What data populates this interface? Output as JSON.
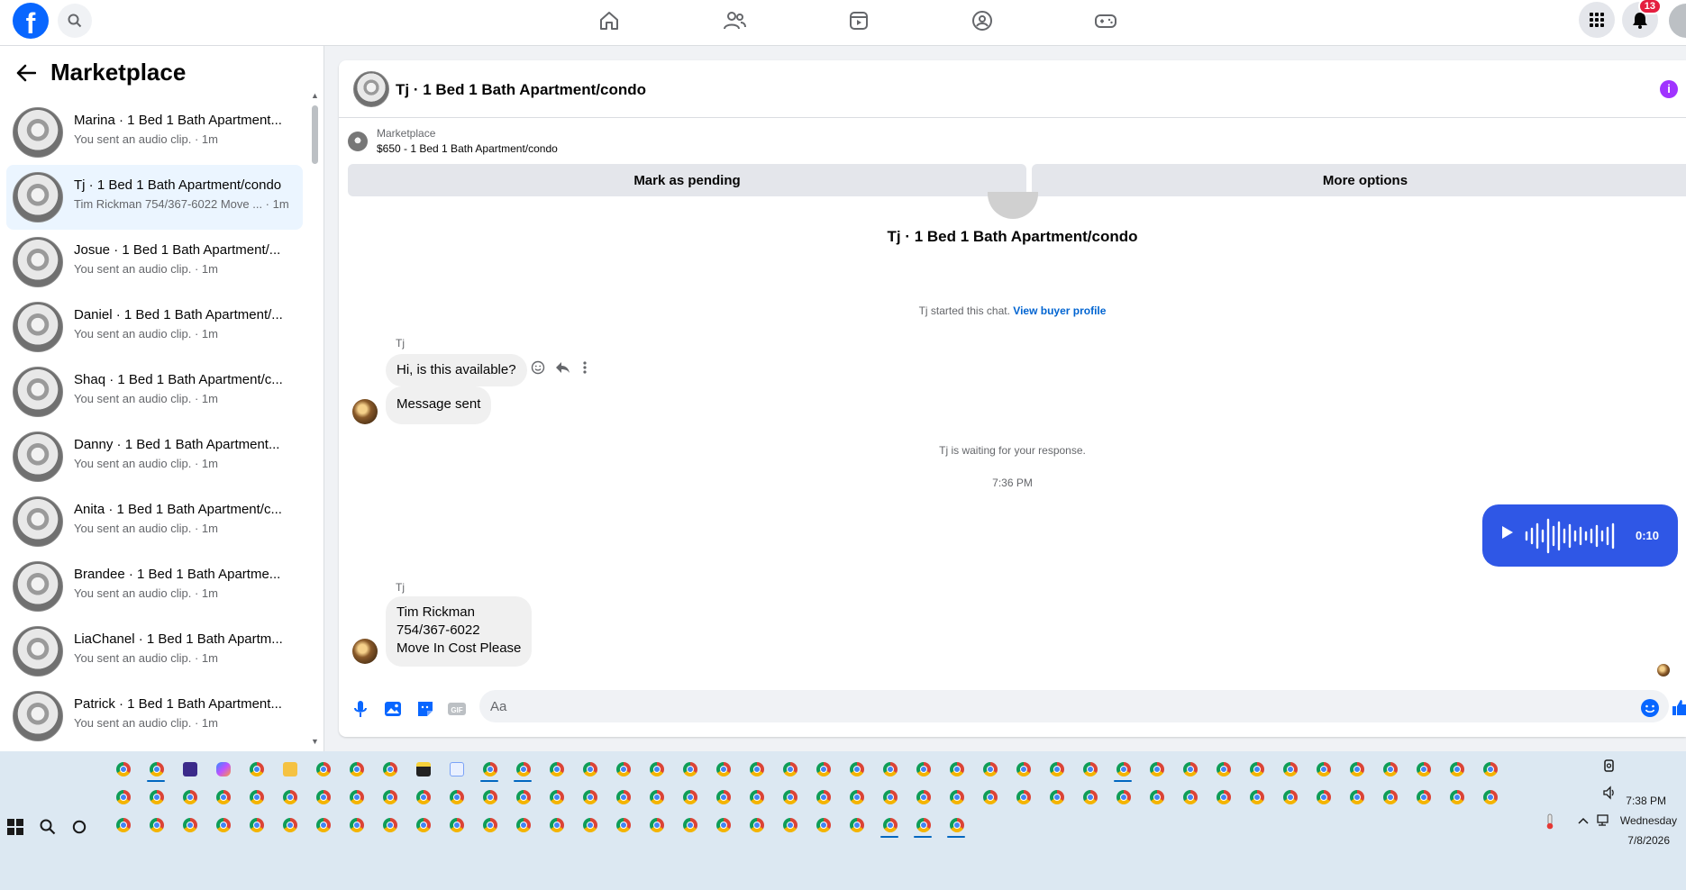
{
  "topbar": {
    "logo": "f",
    "notifications_count": "13",
    "nav_icons": [
      "home-icon",
      "friends-icon",
      "watch-icon",
      "groups-icon",
      "gaming-icon"
    ]
  },
  "marketplace": {
    "title": "Marketplace",
    "conversations": [
      {
        "title": "Marina · 1 Bed 1 Bath Apartment...",
        "sub": "You sent an audio clip. · 1m"
      },
      {
        "title": "Tj · 1 Bed 1 Bath Apartment/condo",
        "sub": "Tim Rickman 754/367-6022 Move ... · 1m"
      },
      {
        "title": "Josue · 1 Bed 1 Bath Apartment/...",
        "sub": "You sent an audio clip. · 1m"
      },
      {
        "title": "Daniel · 1 Bed 1 Bath Apartment/...",
        "sub": "You sent an audio clip. · 1m"
      },
      {
        "title": "Shaq · 1 Bed 1 Bath Apartment/c...",
        "sub": "You sent an audio clip. · 1m"
      },
      {
        "title": "Danny · 1 Bed 1 Bath Apartment...",
        "sub": "You sent an audio clip. · 1m"
      },
      {
        "title": "Anita · 1 Bed 1 Bath Apartment/c...",
        "sub": "You sent an audio clip. · 1m"
      },
      {
        "title": "Brandee · 1 Bed 1 Bath Apartme...",
        "sub": "You sent an audio clip. · 1m"
      },
      {
        "title": "LiaChanel · 1 Bed 1 Bath Apartm...",
        "sub": "You sent an audio clip. · 1m"
      },
      {
        "title": "Patrick · 1 Bed 1 Bath Apartment...",
        "sub": "You sent an audio clip. · 1m"
      }
    ]
  },
  "chat": {
    "header_title": "Tj · 1 Bed 1 Bath Apartment/condo",
    "listing_label": "Marketplace",
    "listing_price": "$650 - 1 Bed 1 Bath Apartment/condo",
    "mark_pending": "Mark as pending",
    "more_options": "More options",
    "center_title": "Tj · 1 Bed 1 Bath Apartment/condo",
    "started_text": "Tj started this chat.",
    "view_profile": "View buyer profile",
    "sender_1": "Tj",
    "msg_1": "Hi, is this available?",
    "msg_2": "Message sent",
    "waiting_text": "Tj is waiting for your response.",
    "time_label": "7:36 PM",
    "audio_duration": "0:10",
    "sender_2": "Tj",
    "msg_3_line1": "Tim Rickman",
    "msg_3_line2": "754/367-6022",
    "msg_3_line3": "Move In Cost Please",
    "input_placeholder": "Aa"
  },
  "taskbar": {
    "time": "7:38 PM",
    "day": "Wednesday",
    "date": "7/8/2026"
  }
}
